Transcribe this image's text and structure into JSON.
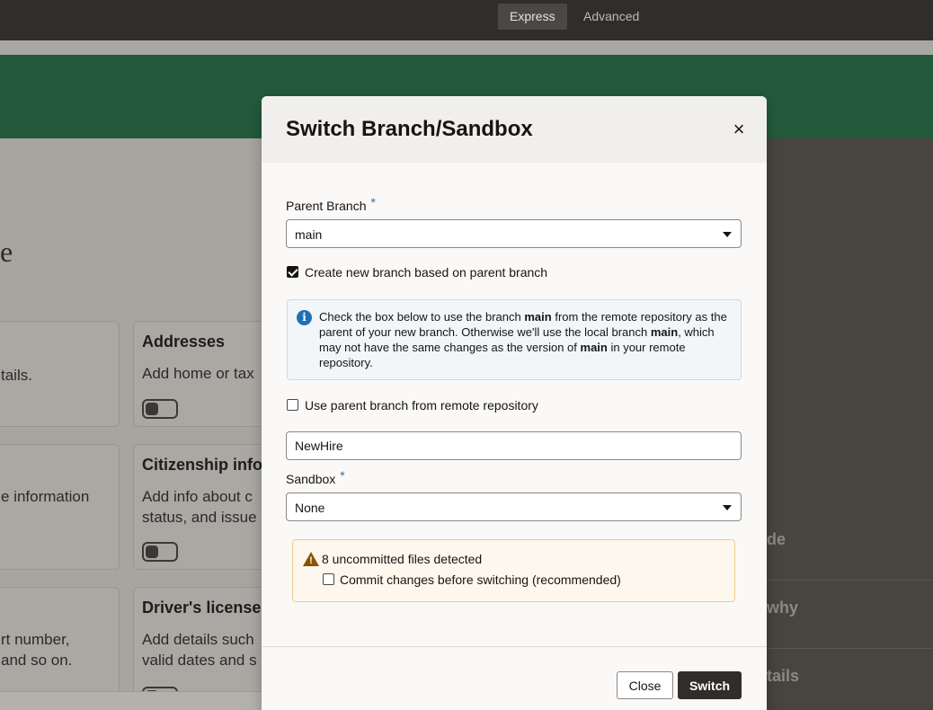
{
  "topbar": {
    "tabs": [
      {
        "label": "Express",
        "active": true
      },
      {
        "label": "Advanced",
        "active": false
      }
    ]
  },
  "background": {
    "page_title_fragment": "e",
    "cards": [
      {
        "title": "Addresses",
        "desc": "Add home or tax",
        "left_fragment": "tails."
      },
      {
        "title": "Citizenship info",
        "desc": "Add info about c",
        "desc2": "status, and issue",
        "left_fragment": "e information"
      },
      {
        "title": "Driver's licenses",
        "desc": "Add details such",
        "desc2": "valid dates and s",
        "left_fragment": "rt number,",
        "left_fragment2": "and so on."
      }
    ],
    "side_items": [
      "de",
      "why",
      "tails"
    ]
  },
  "dialog": {
    "title": "Switch Branch/Sandbox",
    "close_glyph": "×",
    "parent_branch": {
      "label": "Parent Branch",
      "required_mark": "*",
      "value": "main"
    },
    "create_branch": {
      "label": "Create new branch based on parent branch",
      "checked": true
    },
    "info": {
      "icon": "info-icon",
      "p1": "Check the box below to use the branch ",
      "b1": "main",
      "p2": " from the remote repository as the parent of your new branch. Otherwise we'll use the local branch ",
      "b2": "main",
      "p3": ", which may not have the same changes as the version of ",
      "b3": "main",
      "p4": " in your remote repository."
    },
    "use_remote": {
      "label": "Use parent branch from remote repository",
      "checked": false
    },
    "branch_name": {
      "value": "NewHire"
    },
    "sandbox": {
      "label": "Sandbox",
      "required_mark": "*",
      "value": "None"
    },
    "warning": {
      "icon": "warning-icon",
      "text": "8 uncommitted files detected",
      "commit_label": "Commit changes before switching (recommended)",
      "commit_checked": false
    },
    "buttons": {
      "close": "Close",
      "switch": "Switch"
    }
  },
  "colors": {
    "brand_green": "#235a3c",
    "primary_button": "#312d2a",
    "required_blue": "#1f6fb5",
    "warning_brown": "#8a5300"
  }
}
